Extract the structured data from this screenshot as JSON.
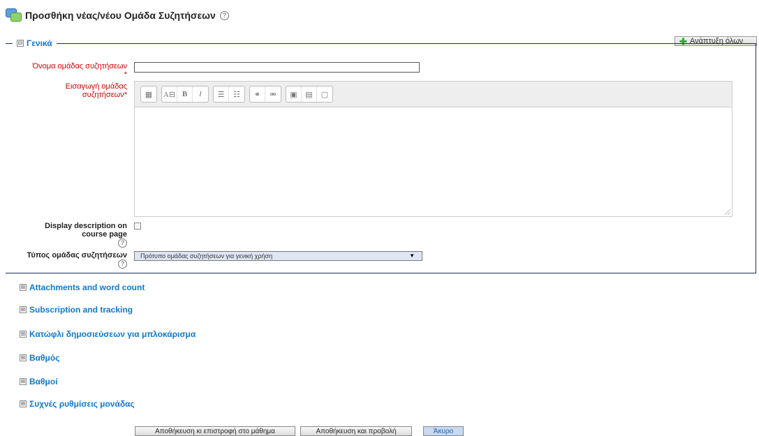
{
  "page": {
    "title": "Προσθήκη νέας/νέου Ομάδα Συζητήσεων",
    "help_glyph": "?",
    "expand_all": "Ανάπτυξη όλων"
  },
  "general": {
    "legend": "Γενικά",
    "collapse_glyph": "⊟",
    "name_label": "Όνομα ομάδας συζητήσεων",
    "required_mark": "*",
    "name_value": "",
    "intro_label_line1": "Εισαγωγή ομάδας",
    "intro_label_line2": "συζητήσεων",
    "display_desc_line1": "Display description on",
    "display_desc_line2": "course page",
    "display_desc_checked": false,
    "type_label": "Τύπος ομάδας συζητήσεων",
    "type_value": "Πρότυπο ομάδας συζητήσεων για γενική χρήση",
    "type_arrow": "▼"
  },
  "editor_toolbar": {
    "groups": [
      [
        "toggle-toolbar-icon"
      ],
      [
        "font-size-icon",
        "Β",
        "I"
      ],
      [
        "unordered-list-icon",
        "ordered-list-icon"
      ],
      [
        "link-icon",
        "unlink-icon"
      ],
      [
        "image-icon",
        "media-icon",
        "manage-files-icon"
      ]
    ],
    "bold": "B",
    "italic": "I"
  },
  "sections": [
    "Attachments and word count",
    "Subscription and tracking",
    "Κατώφλι δημοσιεύσεων για μπλοκάρισμα",
    "Βαθμός",
    "Βαθμοί",
    "Συχνές ρυθμίσεις μονάδας"
  ],
  "sections_expand_glyph": "⊞",
  "buttons": {
    "save_return": "Αποθήκευση κι επιστροφή στο μάθημα",
    "save_display": "Αποθήκευση και προβολή",
    "cancel": "Άκυρο"
  }
}
